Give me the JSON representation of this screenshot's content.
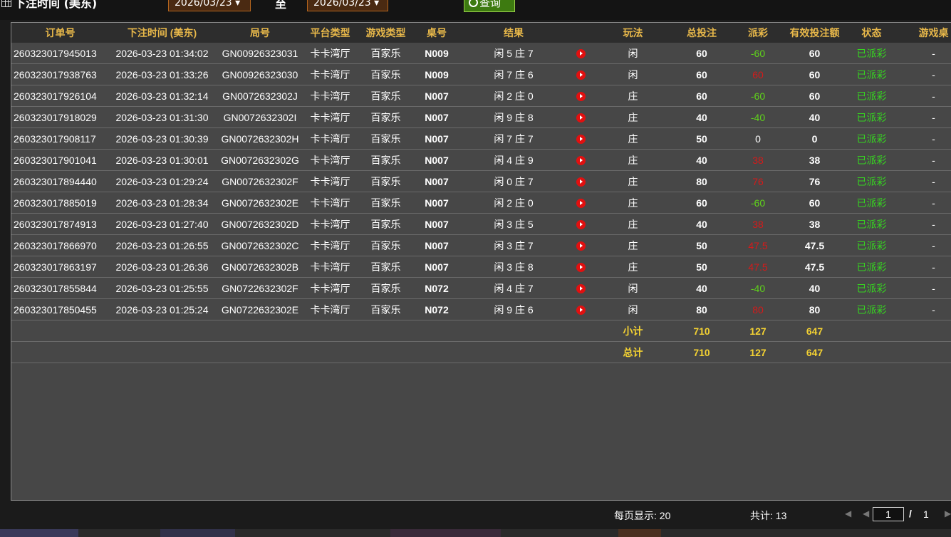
{
  "filter": {
    "label": "下注时间 (美东)",
    "date_from": "2026/03/23 ▾",
    "to_label": "至",
    "date_to": "2026/03/23 ▾",
    "query_button": "查询"
  },
  "table": {
    "headers": [
      "订单号",
      "下注时间 (美东)",
      "局号",
      "平台类型",
      "游戏类型",
      "桌号",
      "结果",
      "",
      "玩法",
      "总投注",
      "派彩",
      "有效投注额",
      "状态",
      "游戏桌"
    ],
    "rows": [
      {
        "order": "260323017945013",
        "time": "2026-03-23 01:34:02",
        "round": "GN00926323031",
        "platform": "卡卡湾厅",
        "game": "百家乐",
        "table": "N009",
        "result": "闲 5 庄 7",
        "play": "闲",
        "bet": "60",
        "payout": "-60",
        "payout_class": "neg",
        "valid": "60",
        "status": "已派彩",
        "extra": "-"
      },
      {
        "order": "260323017938763",
        "time": "2026-03-23 01:33:26",
        "round": "GN00926323030",
        "platform": "卡卡湾厅",
        "game": "百家乐",
        "table": "N009",
        "result": "闲 7 庄 6",
        "play": "闲",
        "bet": "60",
        "payout": "60",
        "payout_class": "pos",
        "valid": "60",
        "status": "已派彩",
        "extra": "-"
      },
      {
        "order": "260323017926104",
        "time": "2026-03-23 01:32:14",
        "round": "GN0072632302J",
        "platform": "卡卡湾厅",
        "game": "百家乐",
        "table": "N007",
        "result": "闲 2 庄 0",
        "play": "庄",
        "bet": "60",
        "payout": "-60",
        "payout_class": "neg",
        "valid": "60",
        "status": "已派彩",
        "extra": "-"
      },
      {
        "order": "260323017918029",
        "time": "2026-03-23 01:31:30",
        "round": "GN0072632302I",
        "platform": "卡卡湾厅",
        "game": "百家乐",
        "table": "N007",
        "result": "闲 9 庄 8",
        "play": "庄",
        "bet": "40",
        "payout": "-40",
        "payout_class": "neg",
        "valid": "40",
        "status": "已派彩",
        "extra": "-"
      },
      {
        "order": "260323017908117",
        "time": "2026-03-23 01:30:39",
        "round": "GN0072632302H",
        "platform": "卡卡湾厅",
        "game": "百家乐",
        "table": "N007",
        "result": "闲 7 庄 7",
        "play": "庄",
        "bet": "50",
        "payout": "0",
        "payout_class": "zero",
        "valid": "0",
        "status": "已派彩",
        "extra": "-"
      },
      {
        "order": "260323017901041",
        "time": "2026-03-23 01:30:01",
        "round": "GN0072632302G",
        "platform": "卡卡湾厅",
        "game": "百家乐",
        "table": "N007",
        "result": "闲 4 庄 9",
        "play": "庄",
        "bet": "40",
        "payout": "38",
        "payout_class": "pos",
        "valid": "38",
        "status": "已派彩",
        "extra": "-"
      },
      {
        "order": "260323017894440",
        "time": "2026-03-23 01:29:24",
        "round": "GN0072632302F",
        "platform": "卡卡湾厅",
        "game": "百家乐",
        "table": "N007",
        "result": "闲 0 庄 7",
        "play": "庄",
        "bet": "80",
        "payout": "76",
        "payout_class": "pos",
        "valid": "76",
        "status": "已派彩",
        "extra": "-"
      },
      {
        "order": "260323017885019",
        "time": "2026-03-23 01:28:34",
        "round": "GN0072632302E",
        "platform": "卡卡湾厅",
        "game": "百家乐",
        "table": "N007",
        "result": "闲 2 庄 0",
        "play": "庄",
        "bet": "60",
        "payout": "-60",
        "payout_class": "neg",
        "valid": "60",
        "status": "已派彩",
        "extra": "-"
      },
      {
        "order": "260323017874913",
        "time": "2026-03-23 01:27:40",
        "round": "GN0072632302D",
        "platform": "卡卡湾厅",
        "game": "百家乐",
        "table": "N007",
        "result": "闲 3 庄 5",
        "play": "庄",
        "bet": "40",
        "payout": "38",
        "payout_class": "pos",
        "valid": "38",
        "status": "已派彩",
        "extra": "-"
      },
      {
        "order": "260323017866970",
        "time": "2026-03-23 01:26:55",
        "round": "GN0072632302C",
        "platform": "卡卡湾厅",
        "game": "百家乐",
        "table": "N007",
        "result": "闲 3 庄 7",
        "play": "庄",
        "bet": "50",
        "payout": "47.5",
        "payout_class": "pos",
        "valid": "47.5",
        "status": "已派彩",
        "extra": "-"
      },
      {
        "order": "260323017863197",
        "time": "2026-03-23 01:26:36",
        "round": "GN0072632302B",
        "platform": "卡卡湾厅",
        "game": "百家乐",
        "table": "N007",
        "result": "闲 3 庄 8",
        "play": "庄",
        "bet": "50",
        "payout": "47.5",
        "payout_class": "pos",
        "valid": "47.5",
        "status": "已派彩",
        "extra": "-"
      },
      {
        "order": "260323017855844",
        "time": "2026-03-23 01:25:55",
        "round": "GN0722632302F",
        "platform": "卡卡湾厅",
        "game": "百家乐",
        "table": "N072",
        "result": "闲 4 庄 7",
        "play": "闲",
        "bet": "40",
        "payout": "-40",
        "payout_class": "neg",
        "valid": "40",
        "status": "已派彩",
        "extra": "-"
      },
      {
        "order": "260323017850455",
        "time": "2026-03-23 01:25:24",
        "round": "GN0722632302E",
        "platform": "卡卡湾厅",
        "game": "百家乐",
        "table": "N072",
        "result": "闲 9 庄 6",
        "play": "闲",
        "bet": "80",
        "payout": "80",
        "payout_class": "pos",
        "valid": "80",
        "status": "已派彩",
        "extra": "-"
      }
    ],
    "subtotal": {
      "label": "小计",
      "bet": "710",
      "payout": "127",
      "valid": "647"
    },
    "total": {
      "label": "总计",
      "bet": "710",
      "payout": "127",
      "valid": "647"
    }
  },
  "pagination": {
    "per_page": "每页显示: 20",
    "total": "共计: 13",
    "current_page": "1",
    "separator": "/",
    "total_pages": "1"
  },
  "colors": {
    "header_text": "#e8b84a",
    "negative_payout": "#5fd31a",
    "positive_payout": "#d41a1a",
    "status": "#36d420",
    "summary_text": "#f4d232"
  }
}
